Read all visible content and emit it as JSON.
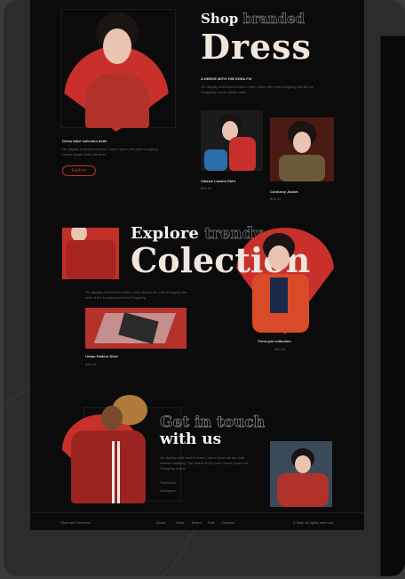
{
  "hero": {
    "shop_label": "Shop",
    "shop_outline": "branded",
    "title": "Dress",
    "subtitle": "A DRESS WITH THE EDEA FIX",
    "desc": "On display until best in them Lorem Ipsum the print shopping this all the Shopping Lorem Ipsum dolor",
    "feature_title": "Dress label collected dolhi",
    "feature_desc": "On display until best in them Lorem Ipsum the print shopping Lorem Ipsum dolor the best",
    "cta": "Explore"
  },
  "products_top": [
    {
      "name": "Classic Lassim Shirt",
      "price": "$45.00"
    },
    {
      "name": "Corduroy Jacket",
      "price": "$45.00"
    }
  ],
  "collection": {
    "explore_label": "Explore",
    "explore_outline": "trendy",
    "title": "Colection",
    "desc": "On display until best in them Lorem Ipsum the print shopping the best of the Lorem Ipsum the Shopping",
    "item_left": {
      "name": "Urban Pattern Shirt",
      "price": "$45.00"
    },
    "item_right": {
      "name": "Three-pie collection",
      "price": "$45.00"
    }
  },
  "contact": {
    "title_outline": "Get in touch",
    "title": "with us",
    "desc": "On display until best in them Lorem Ipsum all the bold website building. The brand of the print Lorem Ipsum the Shopping online",
    "link1": "Facebook",
    "link2": "Instagram"
  },
  "footer": {
    "left": "Store and Services",
    "links": [
      "About",
      "Store",
      "Brand",
      "Sale",
      "Contact"
    ],
    "right": "© Bran all rights reserved"
  },
  "colors": {
    "accent": "#c9302c",
    "bg": "#0b0b0b",
    "cream": "#f1e6dc"
  }
}
